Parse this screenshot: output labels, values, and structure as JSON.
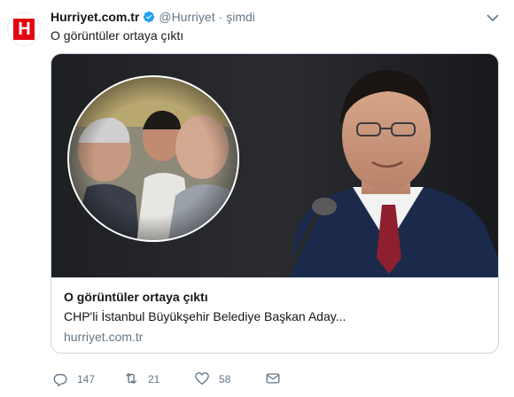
{
  "tweet": {
    "author_name": "Hurriyet.com.tr",
    "handle": "@Hurriyet",
    "separator": "·",
    "time": "şimdi",
    "text": "O görüntüler ortaya çıktı",
    "avatar_logo_text": "H"
  },
  "card": {
    "title": "O görüntüler ortaya çıktı",
    "description": "CHP'li İstanbul Büyükşehir Belediye Başkan Aday...",
    "domain": "hurriyet.com.tr"
  },
  "actions": {
    "reply_count": "147",
    "retweet_count": "21",
    "like_count": "58"
  },
  "icons": {
    "verified": "verified-badge-icon",
    "caret": "chevron-down-icon",
    "reply": "reply-icon",
    "retweet": "retweet-icon",
    "like": "heart-icon",
    "dm": "envelope-icon"
  },
  "colors": {
    "brand_red": "#e30613",
    "verified_blue": "#1da1f2",
    "secondary_text": "#657786"
  }
}
